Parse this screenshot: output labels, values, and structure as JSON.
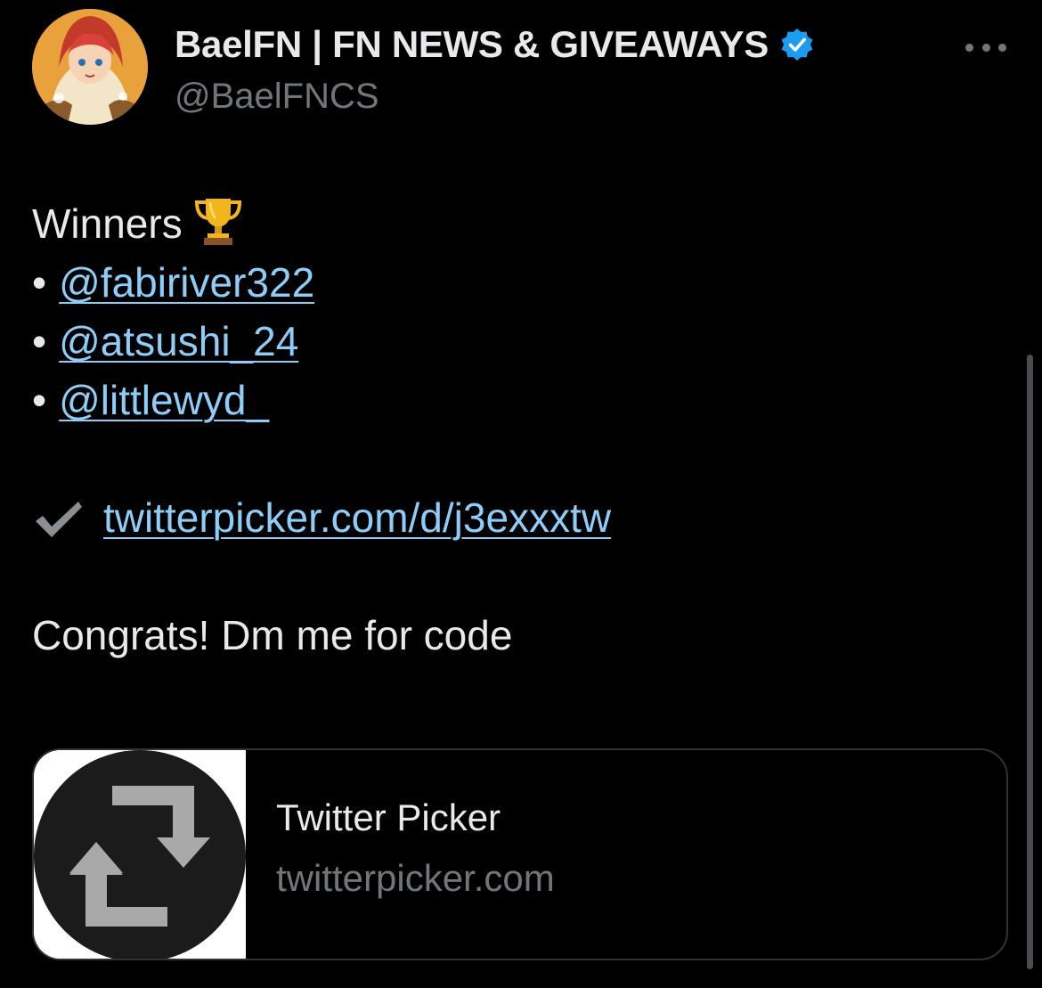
{
  "author": {
    "display_name": "BaelFN | FN NEWS & GIVEAWAYS",
    "handle": "@BaelFNCS",
    "verified": true,
    "verified_color": "#1d9bf0"
  },
  "tweet": {
    "heading": "Winners",
    "heading_icon": "trophy-icon",
    "bullet": "•",
    "winners": [
      "@fabiriver322",
      "@atsushi_24",
      "@littlewyd_"
    ],
    "link_icon": "check-mark-icon",
    "link_text": "twitterpicker.com/d/j3exxxtw",
    "closing": "Congrats! Dm me for code"
  },
  "card": {
    "title": "Twitter Picker",
    "domain": "twitterpicker.com",
    "thumb_icon": "retweet-icon"
  },
  "colors": {
    "background": "#000000",
    "text": "#e7e9ea",
    "secondary_text": "#71767b",
    "link": "#8ecdf8",
    "card_border": "#2f3336"
  }
}
